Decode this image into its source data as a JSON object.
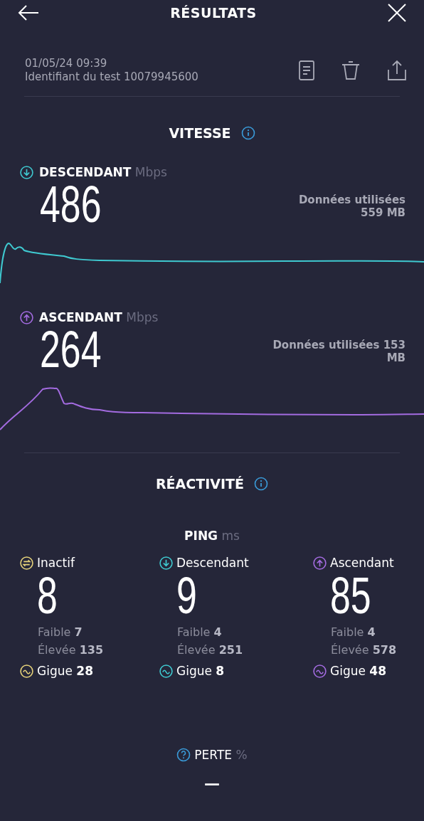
{
  "header": {
    "title": "RÉSULTATS"
  },
  "meta": {
    "datetime": "01/05/24 09:39",
    "test_id": "Identifiant du test 10079945600"
  },
  "speed": {
    "title": "VITESSE",
    "items": [
      {
        "kind": "download",
        "label": "DESCENDANT",
        "unit": "Mbps",
        "value": "486",
        "data_used": "Données utilisées 559 MB",
        "color": "#3fc9d0"
      },
      {
        "kind": "upload",
        "label": "ASCENDANT",
        "unit": "Mbps",
        "value": "264",
        "data_used": "Données utilisées 153 MB",
        "color": "#a36be0"
      }
    ]
  },
  "reactivity": {
    "title": "RÉACTIVITÉ",
    "ping_label": "PING",
    "ping_unit": "ms",
    "columns": [
      {
        "kind": "idle",
        "label": "Inactif",
        "value": "8",
        "low_label": "Faible",
        "low": "7",
        "high_label": "Élevée",
        "high": "135",
        "jitter_label": "Gigue",
        "jitter": "28",
        "color": "#e6d27a"
      },
      {
        "kind": "download",
        "label": "Descendant",
        "value": "9",
        "low_label": "Faible",
        "low": "4",
        "high_label": "Élevée",
        "high": "251",
        "jitter_label": "Gigue",
        "jitter": "8",
        "color": "#3fc9d0"
      },
      {
        "kind": "upload",
        "label": "Ascendant",
        "value": "85",
        "low_label": "Faible",
        "low": "4",
        "high_label": "Élevée",
        "high": "578",
        "jitter_label": "Gigue",
        "jitter": "48",
        "color": "#a36be0"
      }
    ]
  },
  "loss": {
    "label": "PERTE",
    "unit": "%",
    "value": "—"
  }
}
